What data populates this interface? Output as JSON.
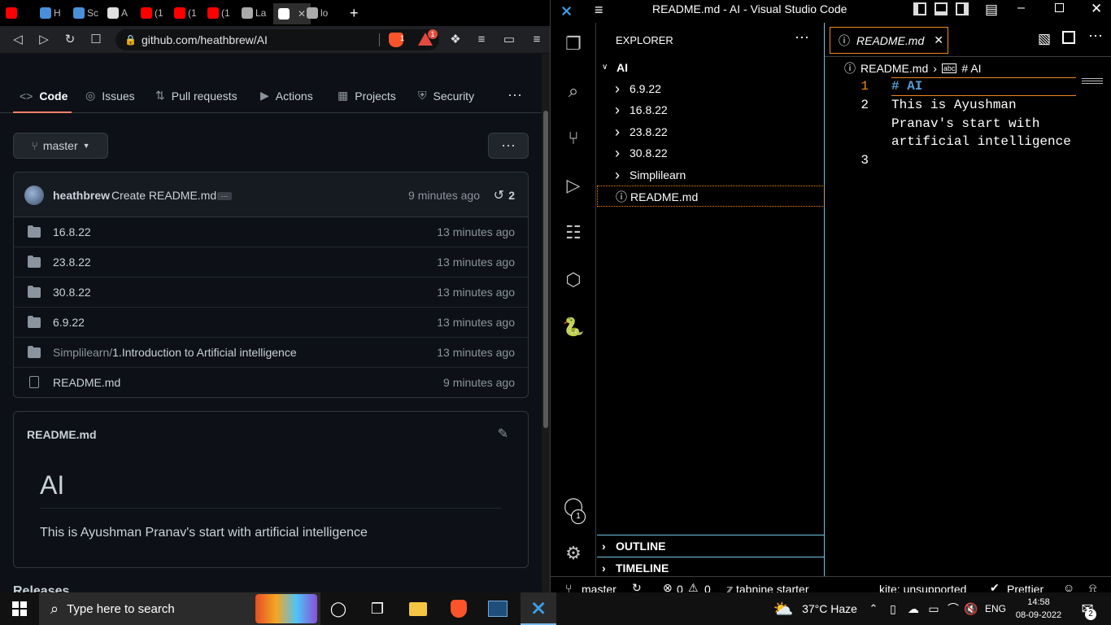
{
  "browser": {
    "tabs": [
      {
        "label": "",
        "icon": "youtube-icon",
        "color": "#ff0000"
      },
      {
        "label": "H",
        "icon": "chrome-icon",
        "color": "#4a90d9"
      },
      {
        "label": "Sc",
        "icon": "chrome-icon",
        "color": "#4a90d9"
      },
      {
        "label": "A",
        "icon": "shield-icon",
        "color": "#e0e0e0"
      },
      {
        "label": "(1",
        "icon": "youtube-icon",
        "color": "#ff0000"
      },
      {
        "label": "(1",
        "icon": "youtube-icon",
        "color": "#ff0000"
      },
      {
        "label": "(1",
        "icon": "youtube-icon",
        "color": "#ff0000"
      },
      {
        "label": "La",
        "icon": "globe-icon",
        "color": "#aaaaaa"
      },
      {
        "label": "",
        "icon": "github-icon",
        "color": "#ffffff"
      },
      {
        "label": "lo",
        "icon": "globe-icon",
        "color": "#aaaaaa"
      }
    ],
    "url": "github.com/heathbrew/AI",
    "brave_badge": "1",
    "rewards_badge": "1"
  },
  "github": {
    "nav": {
      "code": "Code",
      "issues": "Issues",
      "pulls": "Pull requests",
      "actions": "Actions",
      "projects": "Projects",
      "security": "Security"
    },
    "branch": "master",
    "commit": {
      "author": "heathbrew",
      "message": "Create README.md",
      "time": "9 minutes ago",
      "count": "2"
    },
    "files": [
      {
        "name": "16.8.22",
        "prefix": "",
        "time": "13 minutes ago",
        "type": "folder"
      },
      {
        "name": "23.8.22",
        "prefix": "",
        "time": "13 minutes ago",
        "type": "folder"
      },
      {
        "name": "30.8.22",
        "prefix": "",
        "time": "13 minutes ago",
        "type": "folder"
      },
      {
        "name": "6.9.22",
        "prefix": "",
        "time": "13 minutes ago",
        "type": "folder"
      },
      {
        "name": "1.Introduction to Artificial intelligence",
        "prefix": "Simplilearn/",
        "time": "13 minutes ago",
        "type": "folder"
      },
      {
        "name": "README.md",
        "prefix": "",
        "time": "9 minutes ago",
        "type": "file"
      }
    ],
    "readme": {
      "filename": "README.md",
      "heading": "AI",
      "body": "This is Ayushman Pranav's start with artificial intelligence"
    },
    "releases": "Releases"
  },
  "vscode": {
    "title": "README.md - AI - Visual Studio Code",
    "explorer_title": "EXPLORER",
    "root": "AI",
    "tree": [
      {
        "name": "6.9.22",
        "type": "folder"
      },
      {
        "name": "16.8.22",
        "type": "folder"
      },
      {
        "name": "23.8.22",
        "type": "folder"
      },
      {
        "name": "30.8.22",
        "type": "folder"
      },
      {
        "name": "Simplilearn",
        "type": "folder"
      },
      {
        "name": "README.md",
        "type": "file"
      }
    ],
    "outline": "OUTLINE",
    "timeline": "TIMELINE",
    "tab": "README.md",
    "breadcrumb_file": "README.md",
    "breadcrumb_symbol": "# AI",
    "lines": [
      {
        "num": "1",
        "text": "# AI"
      },
      {
        "num": "2",
        "text": "This is Ayushman Pranav's start with artificial intelligence"
      },
      {
        "num": "3",
        "text": ""
      }
    ],
    "wrapped_line2": [
      "This is Ayushman",
      "Pranav's start with",
      "artificial intelligence"
    ],
    "accounts_badge": "1",
    "status": {
      "branch": "master",
      "errors": "0",
      "warnings": "0",
      "tabnine": "tabnine starter",
      "kite": "kite: unsupported",
      "prettier": "Prettier"
    }
  },
  "taskbar": {
    "search_placeholder": "Type here to search",
    "weather": "37°C  Haze",
    "language": "ENG",
    "time": "14:58",
    "date": "08-09-2022",
    "notifications": "2"
  }
}
